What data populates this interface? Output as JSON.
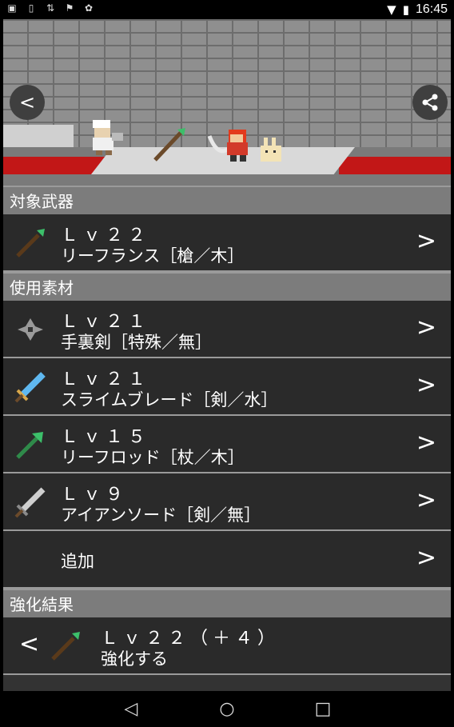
{
  "status_bar": {
    "left_icons": [
      "image-icon",
      "sim-icon",
      "sync-icon",
      "flag-icon",
      "android-icon"
    ],
    "right_icons": [
      "wifi-icon",
      "battery-icon"
    ],
    "time": "16:45"
  },
  "scene": {
    "back_label": "<",
    "share_icon": "share-icon"
  },
  "sections": {
    "target_header": "対象武器",
    "materials_header": "使用素材",
    "result_header": "強化結果"
  },
  "target": {
    "level": "Ｌｖ２２",
    "name": "リーフランス［槍／木］",
    "icon": "spear-icon"
  },
  "materials": [
    {
      "level": "Ｌｖ２１",
      "name": "手裏剣［特殊／無］",
      "icon": "shuriken-icon"
    },
    {
      "level": "Ｌｖ２１",
      "name": "スライムブレード［剣／水］",
      "icon": "blue-sword-icon"
    },
    {
      "level": "Ｌｖ１５",
      "name": "リーフロッド［杖／木］",
      "icon": "staff-icon"
    },
    {
      "level": "Ｌｖ９",
      "name": "アイアンソード［剣／無］",
      "icon": "iron-sword-icon"
    }
  ],
  "add_label": "追加",
  "chevron": ">",
  "result": {
    "back": "<",
    "level": "Ｌｖ２２（＋４）",
    "action": "強化する",
    "icon": "spear-icon"
  },
  "nav": {
    "back": "◁",
    "home": "○",
    "recent": "□"
  }
}
